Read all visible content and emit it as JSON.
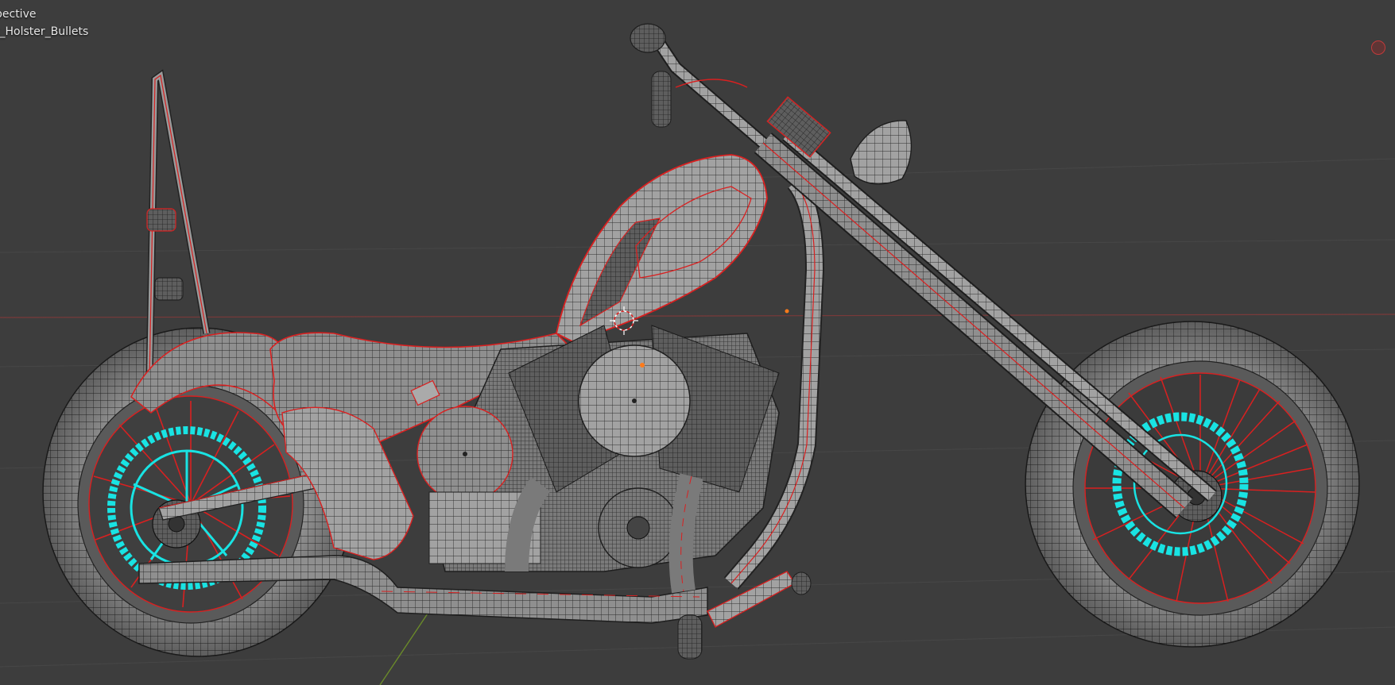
{
  "viewport": {
    "view_mode": "User Perspective",
    "object_name": "Gun_Holster_Bullets",
    "view_mode_visible": "pective",
    "object_name_visible": "t_Holster_Bullets"
  },
  "colors": {
    "background": "#3d3d3d",
    "grid_line": "#474747",
    "x_axis": "#8a3a3a",
    "y_axis": "#6a8a2a",
    "mesh_fill": "#8d8d8d",
    "mesh_wire": "#1e1e1e",
    "seam_red": "#d92020",
    "selected_cyan": "#19e3e3"
  },
  "icons": {
    "record": "record-icon",
    "cursor": "3d-cursor-icon"
  }
}
